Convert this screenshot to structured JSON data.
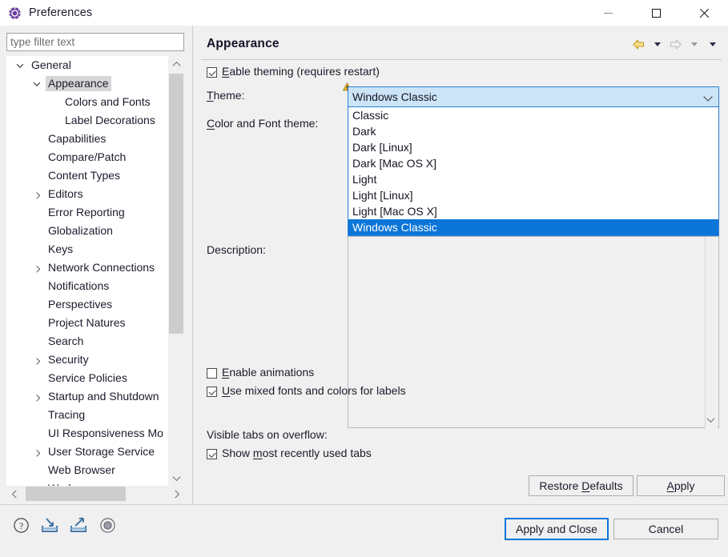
{
  "window": {
    "title": "Preferences",
    "icon": "preferences-gear-icon",
    "controls": {
      "minimize": "minimize",
      "maximize": "maximize",
      "close": "close"
    }
  },
  "filter": {
    "placeholder": "type filter text",
    "value": ""
  },
  "tree": {
    "items": [
      {
        "label": "General",
        "indent": 0,
        "expander": "down",
        "selected": false
      },
      {
        "label": "Appearance",
        "indent": 1,
        "expander": "down",
        "selected": true
      },
      {
        "label": "Colors and Fonts",
        "indent": 2,
        "expander": "none",
        "selected": false
      },
      {
        "label": "Label Decorations",
        "indent": 2,
        "expander": "none",
        "selected": false
      },
      {
        "label": "Capabilities",
        "indent": 1,
        "expander": "none",
        "selected": false
      },
      {
        "label": "Compare/Patch",
        "indent": 1,
        "expander": "none",
        "selected": false
      },
      {
        "label": "Content Types",
        "indent": 1,
        "expander": "none",
        "selected": false
      },
      {
        "label": "Editors",
        "indent": 1,
        "expander": "right",
        "selected": false
      },
      {
        "label": "Error Reporting",
        "indent": 1,
        "expander": "none",
        "selected": false
      },
      {
        "label": "Globalization",
        "indent": 1,
        "expander": "none",
        "selected": false
      },
      {
        "label": "Keys",
        "indent": 1,
        "expander": "none",
        "selected": false
      },
      {
        "label": "Network Connections",
        "indent": 1,
        "expander": "right",
        "selected": false
      },
      {
        "label": "Notifications",
        "indent": 1,
        "expander": "none",
        "selected": false
      },
      {
        "label": "Perspectives",
        "indent": 1,
        "expander": "none",
        "selected": false
      },
      {
        "label": "Project Natures",
        "indent": 1,
        "expander": "none",
        "selected": false
      },
      {
        "label": "Search",
        "indent": 1,
        "expander": "none",
        "selected": false
      },
      {
        "label": "Security",
        "indent": 1,
        "expander": "right",
        "selected": false
      },
      {
        "label": "Service Policies",
        "indent": 1,
        "expander": "none",
        "selected": false
      },
      {
        "label": "Startup and Shutdown",
        "indent": 1,
        "expander": "right",
        "selected": false
      },
      {
        "label": "Tracing",
        "indent": 1,
        "expander": "none",
        "selected": false
      },
      {
        "label": "UI Responsiveness Mo",
        "indent": 1,
        "expander": "none",
        "selected": false
      },
      {
        "label": "User Storage Service",
        "indent": 1,
        "expander": "right",
        "selected": false
      },
      {
        "label": "Web Browser",
        "indent": 1,
        "expander": "none",
        "selected": false
      },
      {
        "label": "Workspace",
        "indent": 1,
        "expander": "right",
        "selected": false
      }
    ]
  },
  "page": {
    "title": "Appearance",
    "nav": {
      "back": "back-arrow",
      "back_menu": "back-dropdown",
      "forward": "forward-arrow",
      "forward_menu": "forward-dropdown",
      "view_menu": "view-menu"
    },
    "enable_theming": {
      "label": "Enable theming (requires restart)",
      "mnemonic": "n",
      "checked": true
    },
    "theme": {
      "label": "Theme:",
      "mnemonic": "T",
      "value": "Windows Classic",
      "warning": true,
      "options": [
        "Classic",
        "Dark",
        "Dark [Linux]",
        "Dark [Mac OS X]",
        "Light",
        "Light [Linux]",
        "Light [Mac OS X]",
        "Windows Classic"
      ],
      "selected_option": "Windows Classic",
      "open": true
    },
    "color_font_theme": {
      "label": "Color and Font theme:",
      "mnemonic": "C"
    },
    "description": {
      "label": "Description:",
      "value": ""
    },
    "enable_animations": {
      "label": "Enable animations",
      "mnemonic": "E",
      "checked": false
    },
    "use_mixed_fonts": {
      "label": "Use mixed fonts and colors for labels",
      "mnemonic": "U",
      "checked": true
    },
    "visible_tabs_label": "Visible tabs on overflow:",
    "show_mru_tabs": {
      "label": "Show most recently used tabs",
      "mnemonic": "m",
      "checked": true
    }
  },
  "buttons": {
    "restore_defaults": "Restore Defaults",
    "apply": "Apply",
    "apply_and_close": "Apply and Close",
    "cancel": "Cancel"
  },
  "footer": {
    "icons": [
      "help-icon",
      "import-icon",
      "export-icon",
      "record-icon"
    ]
  },
  "colors": {
    "accent": "#0b76d8",
    "combo_fill": "#cce4f7",
    "selection": "#0b76d8",
    "panel": "#f0f0f0",
    "title_icon": "#6b3fa0",
    "warning": "#f0b23c"
  }
}
